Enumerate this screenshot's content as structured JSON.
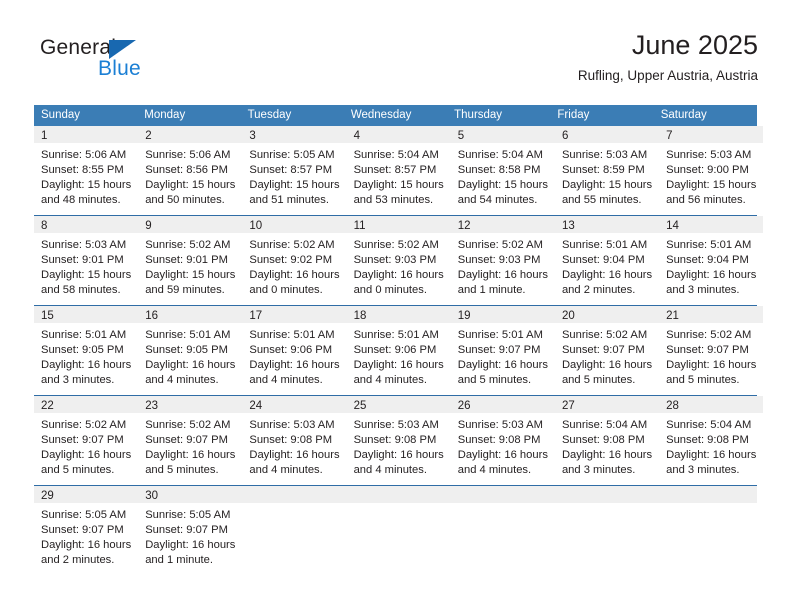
{
  "logo": {
    "primary_text": "General",
    "secondary_text": "Blue",
    "triangle_color": "#1868b0",
    "secondary_color": "#1b7fd4"
  },
  "header": {
    "title": "June 2025",
    "subtitle": "Rufling, Upper Austria, Austria"
  },
  "theme": {
    "header_blue": "#3b7db5",
    "row_divider_blue": "#2f6da6",
    "day_band_gray": "#efefef",
    "text_color": "#231f20"
  },
  "calendar": {
    "weekday_headers": [
      "Sunday",
      "Monday",
      "Tuesday",
      "Wednesday",
      "Thursday",
      "Friday",
      "Saturday"
    ],
    "weeks": [
      [
        {
          "day": "1",
          "sunrise": "Sunrise: 5:06 AM",
          "sunset": "Sunset: 8:55 PM",
          "daylight_1": "Daylight: 15 hours",
          "daylight_2": "and 48 minutes."
        },
        {
          "day": "2",
          "sunrise": "Sunrise: 5:06 AM",
          "sunset": "Sunset: 8:56 PM",
          "daylight_1": "Daylight: 15 hours",
          "daylight_2": "and 50 minutes."
        },
        {
          "day": "3",
          "sunrise": "Sunrise: 5:05 AM",
          "sunset": "Sunset: 8:57 PM",
          "daylight_1": "Daylight: 15 hours",
          "daylight_2": "and 51 minutes."
        },
        {
          "day": "4",
          "sunrise": "Sunrise: 5:04 AM",
          "sunset": "Sunset: 8:57 PM",
          "daylight_1": "Daylight: 15 hours",
          "daylight_2": "and 53 minutes."
        },
        {
          "day": "5",
          "sunrise": "Sunrise: 5:04 AM",
          "sunset": "Sunset: 8:58 PM",
          "daylight_1": "Daylight: 15 hours",
          "daylight_2": "and 54 minutes."
        },
        {
          "day": "6",
          "sunrise": "Sunrise: 5:03 AM",
          "sunset": "Sunset: 8:59 PM",
          "daylight_1": "Daylight: 15 hours",
          "daylight_2": "and 55 minutes."
        },
        {
          "day": "7",
          "sunrise": "Sunrise: 5:03 AM",
          "sunset": "Sunset: 9:00 PM",
          "daylight_1": "Daylight: 15 hours",
          "daylight_2": "and 56 minutes."
        }
      ],
      [
        {
          "day": "8",
          "sunrise": "Sunrise: 5:03 AM",
          "sunset": "Sunset: 9:01 PM",
          "daylight_1": "Daylight: 15 hours",
          "daylight_2": "and 58 minutes."
        },
        {
          "day": "9",
          "sunrise": "Sunrise: 5:02 AM",
          "sunset": "Sunset: 9:01 PM",
          "daylight_1": "Daylight: 15 hours",
          "daylight_2": "and 59 minutes."
        },
        {
          "day": "10",
          "sunrise": "Sunrise: 5:02 AM",
          "sunset": "Sunset: 9:02 PM",
          "daylight_1": "Daylight: 16 hours",
          "daylight_2": "and 0 minutes."
        },
        {
          "day": "11",
          "sunrise": "Sunrise: 5:02 AM",
          "sunset": "Sunset: 9:03 PM",
          "daylight_1": "Daylight: 16 hours",
          "daylight_2": "and 0 minutes."
        },
        {
          "day": "12",
          "sunrise": "Sunrise: 5:02 AM",
          "sunset": "Sunset: 9:03 PM",
          "daylight_1": "Daylight: 16 hours",
          "daylight_2": "and 1 minute."
        },
        {
          "day": "13",
          "sunrise": "Sunrise: 5:01 AM",
          "sunset": "Sunset: 9:04 PM",
          "daylight_1": "Daylight: 16 hours",
          "daylight_2": "and 2 minutes."
        },
        {
          "day": "14",
          "sunrise": "Sunrise: 5:01 AM",
          "sunset": "Sunset: 9:04 PM",
          "daylight_1": "Daylight: 16 hours",
          "daylight_2": "and 3 minutes."
        }
      ],
      [
        {
          "day": "15",
          "sunrise": "Sunrise: 5:01 AM",
          "sunset": "Sunset: 9:05 PM",
          "daylight_1": "Daylight: 16 hours",
          "daylight_2": "and 3 minutes."
        },
        {
          "day": "16",
          "sunrise": "Sunrise: 5:01 AM",
          "sunset": "Sunset: 9:05 PM",
          "daylight_1": "Daylight: 16 hours",
          "daylight_2": "and 4 minutes."
        },
        {
          "day": "17",
          "sunrise": "Sunrise: 5:01 AM",
          "sunset": "Sunset: 9:06 PM",
          "daylight_1": "Daylight: 16 hours",
          "daylight_2": "and 4 minutes."
        },
        {
          "day": "18",
          "sunrise": "Sunrise: 5:01 AM",
          "sunset": "Sunset: 9:06 PM",
          "daylight_1": "Daylight: 16 hours",
          "daylight_2": "and 4 minutes."
        },
        {
          "day": "19",
          "sunrise": "Sunrise: 5:01 AM",
          "sunset": "Sunset: 9:07 PM",
          "daylight_1": "Daylight: 16 hours",
          "daylight_2": "and 5 minutes."
        },
        {
          "day": "20",
          "sunrise": "Sunrise: 5:02 AM",
          "sunset": "Sunset: 9:07 PM",
          "daylight_1": "Daylight: 16 hours",
          "daylight_2": "and 5 minutes."
        },
        {
          "day": "21",
          "sunrise": "Sunrise: 5:02 AM",
          "sunset": "Sunset: 9:07 PM",
          "daylight_1": "Daylight: 16 hours",
          "daylight_2": "and 5 minutes."
        }
      ],
      [
        {
          "day": "22",
          "sunrise": "Sunrise: 5:02 AM",
          "sunset": "Sunset: 9:07 PM",
          "daylight_1": "Daylight: 16 hours",
          "daylight_2": "and 5 minutes."
        },
        {
          "day": "23",
          "sunrise": "Sunrise: 5:02 AM",
          "sunset": "Sunset: 9:07 PM",
          "daylight_1": "Daylight: 16 hours",
          "daylight_2": "and 5 minutes."
        },
        {
          "day": "24",
          "sunrise": "Sunrise: 5:03 AM",
          "sunset": "Sunset: 9:08 PM",
          "daylight_1": "Daylight: 16 hours",
          "daylight_2": "and 4 minutes."
        },
        {
          "day": "25",
          "sunrise": "Sunrise: 5:03 AM",
          "sunset": "Sunset: 9:08 PM",
          "daylight_1": "Daylight: 16 hours",
          "daylight_2": "and 4 minutes."
        },
        {
          "day": "26",
          "sunrise": "Sunrise: 5:03 AM",
          "sunset": "Sunset: 9:08 PM",
          "daylight_1": "Daylight: 16 hours",
          "daylight_2": "and 4 minutes."
        },
        {
          "day": "27",
          "sunrise": "Sunrise: 5:04 AM",
          "sunset": "Sunset: 9:08 PM",
          "daylight_1": "Daylight: 16 hours",
          "daylight_2": "and 3 minutes."
        },
        {
          "day": "28",
          "sunrise": "Sunrise: 5:04 AM",
          "sunset": "Sunset: 9:08 PM",
          "daylight_1": "Daylight: 16 hours",
          "daylight_2": "and 3 minutes."
        }
      ],
      [
        {
          "day": "29",
          "sunrise": "Sunrise: 5:05 AM",
          "sunset": "Sunset: 9:07 PM",
          "daylight_1": "Daylight: 16 hours",
          "daylight_2": "and 2 minutes."
        },
        {
          "day": "30",
          "sunrise": "Sunrise: 5:05 AM",
          "sunset": "Sunset: 9:07 PM",
          "daylight_1": "Daylight: 16 hours",
          "daylight_2": "and 1 minute."
        },
        {
          "day": "",
          "sunrise": "",
          "sunset": "",
          "daylight_1": "",
          "daylight_2": ""
        },
        {
          "day": "",
          "sunrise": "",
          "sunset": "",
          "daylight_1": "",
          "daylight_2": ""
        },
        {
          "day": "",
          "sunrise": "",
          "sunset": "",
          "daylight_1": "",
          "daylight_2": ""
        },
        {
          "day": "",
          "sunrise": "",
          "sunset": "",
          "daylight_1": "",
          "daylight_2": ""
        },
        {
          "day": "",
          "sunrise": "",
          "sunset": "",
          "daylight_1": "",
          "daylight_2": ""
        }
      ]
    ]
  }
}
